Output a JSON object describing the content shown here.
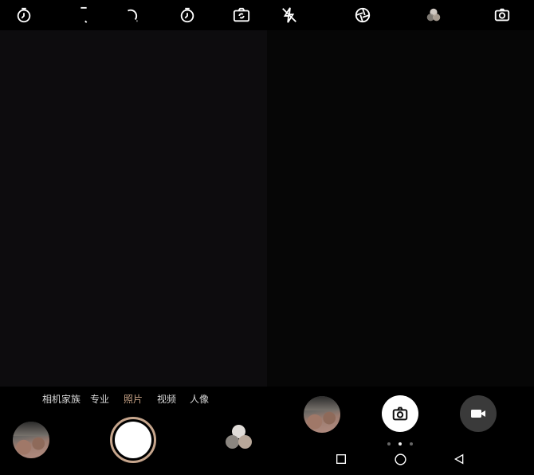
{
  "left_screen": {
    "top_icons": [
      "timer-icon",
      "flash-icon",
      "aperture-icon",
      "timer-icon",
      "switch-camera-icon"
    ],
    "modes": [
      {
        "label": "相机家族",
        "active": false
      },
      {
        "label": "专业",
        "active": false
      },
      {
        "label": "照片",
        "active": true
      },
      {
        "label": "视频",
        "active": false
      },
      {
        "label": "人像",
        "active": false
      }
    ],
    "accent_color": "#c9a487"
  },
  "right_screen": {
    "top_icons": [
      "flash-off-icon",
      "aperture-icon",
      "filter-icon",
      "switch-camera-icon"
    ],
    "pager_dots": 3,
    "pager_active_index": 1,
    "nav_buttons": [
      "back-square-icon",
      "home-circle-icon",
      "back-triangle-icon"
    ]
  }
}
